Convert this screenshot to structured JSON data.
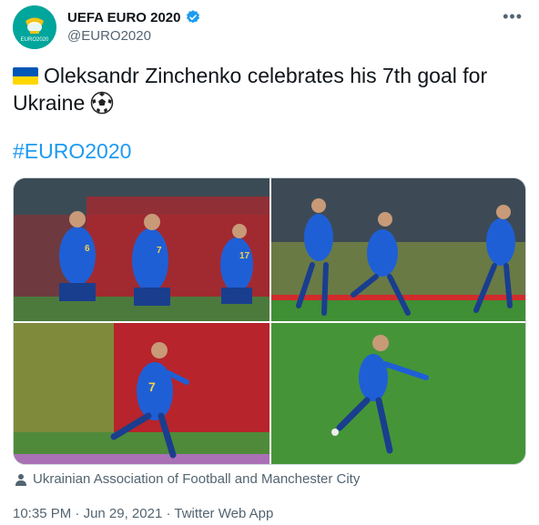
{
  "account": {
    "display_name": "UEFA EURO 2020",
    "handle": "@EURO2020",
    "avatar_text": "EURO2020",
    "verified": true
  },
  "tweet": {
    "flag_emoji": "ukraine-flag",
    "text_line": "Oleksandr Zinchenko celebrates his 7th goal for Ukraine",
    "ball_emoji": "soccer-ball",
    "hashtag": "#EURO2020"
  },
  "media": {
    "photo_count": 4,
    "credit": "Ukrainian Association of Football and Manchester City"
  },
  "meta": {
    "time": "10:35 PM",
    "date": "Jun 29, 2021",
    "source": "Twitter Web App",
    "separator": " · "
  },
  "icons": {
    "more": "more-icon",
    "verified": "verified-badge-icon",
    "person": "person-icon"
  },
  "colors": {
    "link": "#1d9bf0",
    "secondary_text": "#536471",
    "verified": "#1d9bf0",
    "jersey": "#1f5fd6",
    "pitch": "#3f8f34",
    "stands_red": "#b7242b"
  }
}
